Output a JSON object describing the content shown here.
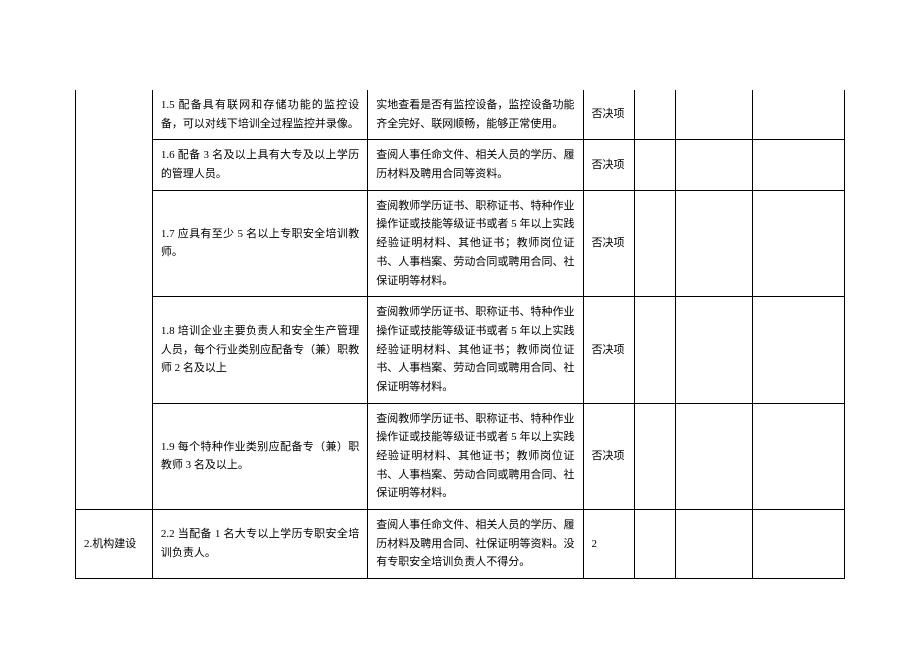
{
  "rows": [
    {
      "req": "1.5 配备具有联网和存储功能的监控设备，可以对线下培训全过程监控并录像。",
      "desc": "实地查看是否有监控设备，监控设备功能齐全完好、联网顺畅，能够正常使用。",
      "score": "否决项"
    },
    {
      "req": "1.6 配备 3 名及以上具有大专及以上学历的管理人员。",
      "desc": "查阅人事任命文件、相关人员的学历、履历材料及聘用合同等资料。",
      "score": "否决项"
    },
    {
      "req": "1.7 应具有至少 5 名以上专职安全培训教师。",
      "desc": "查阅教师学历证书、职称证书、特种作业操作证或技能等级证书或者 5 年以上实践经验证明材料、其他证书；教师岗位证书、人事档案、劳动合同或聘用合同、社保证明等材料。",
      "score": "否决项"
    },
    {
      "req": "1.8 培训企业主要负责人和安全生产管理人员，每个行业类别应配备专（兼）职教师 2 名及以上",
      "desc": "查阅教师学历证书、职称证书、特种作业操作证或技能等级证书或者 5 年以上实践经验证明材料、其他证书；教师岗位证书、人事档案、劳动合同或聘用合同、社保证明等材料。",
      "score": "否决项"
    },
    {
      "req": "1.9 每个特种作业类别应配备专（兼）职教师 3 名及以上。",
      "desc": "查阅教师学历证书、职称证书、特种作业操作证或技能等级证书或者 5 年以上实践经验证明材料、其他证书；教师岗位证书、人事档案、劳动合同或聘用合同、社保证明等材料。",
      "score": "否决项"
    },
    {
      "category": "2.机构建设",
      "req": "2.2 当配备 1 名大专以上学历专职安全培训负责人。",
      "desc": "查阅人事任命文件、相关人员的学历、履历材料及聘用合同、社保证明等资料。没有专职安全培训负责人不得分。",
      "score": "2"
    }
  ]
}
